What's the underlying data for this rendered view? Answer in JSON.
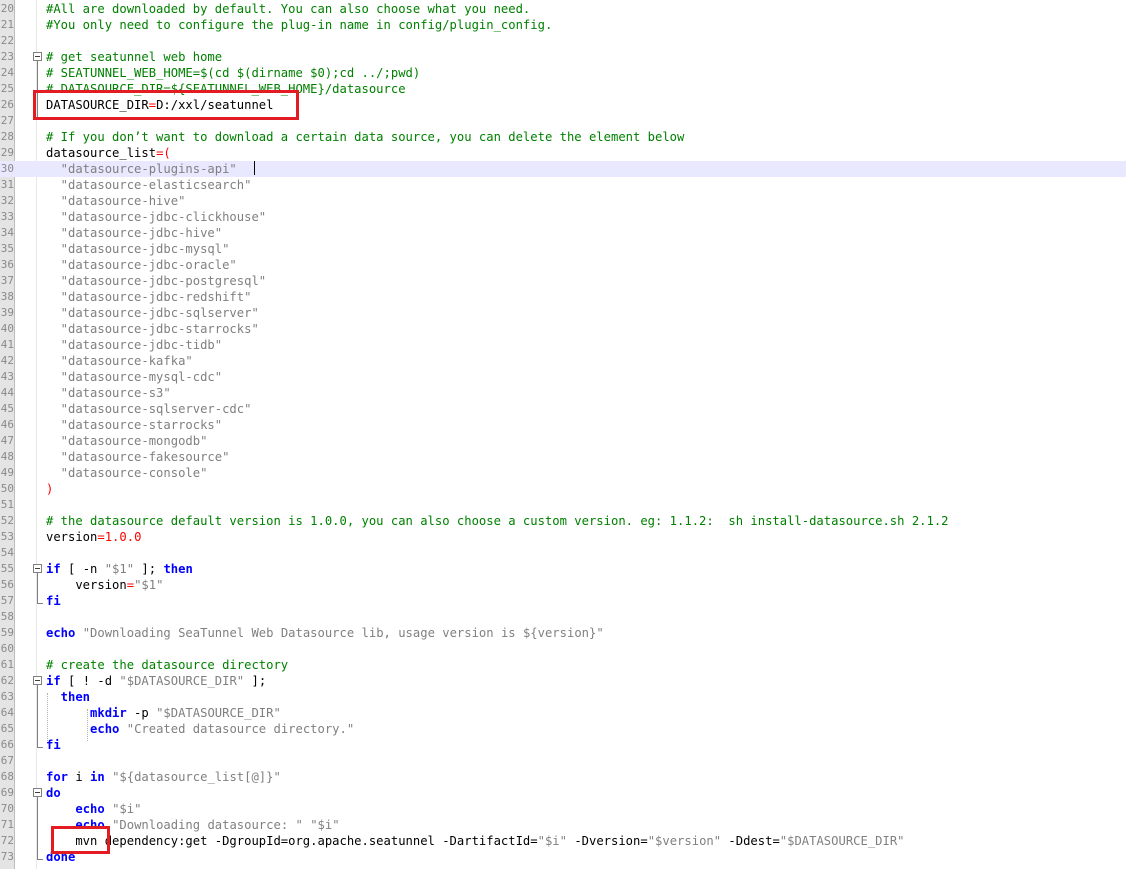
{
  "editor": {
    "lines": [
      {
        "no": "20",
        "parts": [
          {
            "c": "com",
            "t": "#All are downloaded by default. You can also choose what you need."
          }
        ]
      },
      {
        "no": "21",
        "parts": [
          {
            "c": "com",
            "t": "#You only need to configure the plug-in name in config/plugin_config."
          }
        ]
      },
      {
        "no": "22",
        "parts": []
      },
      {
        "no": "23",
        "parts": [
          {
            "c": "com",
            "t": "# get seatunnel web home"
          }
        ]
      },
      {
        "no": "24",
        "parts": [
          {
            "c": "com",
            "t": "# SEATUNNEL_WEB_HOME=$(cd $(dirname $0);cd ../;pwd)"
          }
        ]
      },
      {
        "no": "25",
        "parts": [
          {
            "c": "com",
            "t": "# DATASOURCE_DIR=${SEATUNNEL_WEB_HOME}/datasource"
          }
        ]
      },
      {
        "no": "26",
        "parts": [
          {
            "c": "plain",
            "t": "DATASOURCE_DIR"
          },
          {
            "c": "op",
            "t": "="
          },
          {
            "c": "plain",
            "t": "D:/xxl/seatunnel"
          }
        ]
      },
      {
        "no": "27",
        "parts": []
      },
      {
        "no": "28",
        "parts": [
          {
            "c": "com",
            "t": "# If you don’t want to download a certain data source, you can delete the element below"
          }
        ]
      },
      {
        "no": "29",
        "parts": [
          {
            "c": "plain",
            "t": "datasource_list"
          },
          {
            "c": "op",
            "t": "=("
          }
        ]
      },
      {
        "no": "30",
        "parts": [
          {
            "c": "str",
            "t": "  \"datasource-plugins-api\""
          }
        ]
      },
      {
        "no": "31",
        "parts": [
          {
            "c": "str",
            "t": "  \"datasource-elasticsearch\""
          }
        ]
      },
      {
        "no": "32",
        "parts": [
          {
            "c": "str",
            "t": "  \"datasource-hive\""
          }
        ]
      },
      {
        "no": "33",
        "parts": [
          {
            "c": "str",
            "t": "  \"datasource-jdbc-clickhouse\""
          }
        ]
      },
      {
        "no": "34",
        "parts": [
          {
            "c": "str",
            "t": "  \"datasource-jdbc-hive\""
          }
        ]
      },
      {
        "no": "35",
        "parts": [
          {
            "c": "str",
            "t": "  \"datasource-jdbc-mysql\""
          }
        ]
      },
      {
        "no": "36",
        "parts": [
          {
            "c": "str",
            "t": "  \"datasource-jdbc-oracle\""
          }
        ]
      },
      {
        "no": "37",
        "parts": [
          {
            "c": "str",
            "t": "  \"datasource-jdbc-postgresql\""
          }
        ]
      },
      {
        "no": "38",
        "parts": [
          {
            "c": "str",
            "t": "  \"datasource-jdbc-redshift\""
          }
        ]
      },
      {
        "no": "39",
        "parts": [
          {
            "c": "str",
            "t": "  \"datasource-jdbc-sqlserver\""
          }
        ]
      },
      {
        "no": "40",
        "parts": [
          {
            "c": "str",
            "t": "  \"datasource-jdbc-starrocks\""
          }
        ]
      },
      {
        "no": "41",
        "parts": [
          {
            "c": "str",
            "t": "  \"datasource-jdbc-tidb\""
          }
        ]
      },
      {
        "no": "42",
        "parts": [
          {
            "c": "str",
            "t": "  \"datasource-kafka\""
          }
        ]
      },
      {
        "no": "43",
        "parts": [
          {
            "c": "str",
            "t": "  \"datasource-mysql-cdc\""
          }
        ]
      },
      {
        "no": "44",
        "parts": [
          {
            "c": "str",
            "t": "  \"datasource-s3\""
          }
        ]
      },
      {
        "no": "45",
        "parts": [
          {
            "c": "str",
            "t": "  \"datasource-sqlserver-cdc\""
          }
        ]
      },
      {
        "no": "46",
        "parts": [
          {
            "c": "str",
            "t": "  \"datasource-starrocks\""
          }
        ]
      },
      {
        "no": "47",
        "parts": [
          {
            "c": "str",
            "t": "  \"datasource-mongodb\""
          }
        ]
      },
      {
        "no": "48",
        "parts": [
          {
            "c": "str",
            "t": "  \"datasource-fakesource\""
          }
        ]
      },
      {
        "no": "49",
        "parts": [
          {
            "c": "str",
            "t": "  \"datasource-console\""
          }
        ]
      },
      {
        "no": "50",
        "parts": [
          {
            "c": "op",
            "t": ")"
          }
        ]
      },
      {
        "no": "51",
        "parts": []
      },
      {
        "no": "52",
        "parts": [
          {
            "c": "com",
            "t": "# the datasource default version is 1.0.0, you can also choose a custom version. eg: 1.1.2:  sh install-datasource.sh 2.1.2"
          }
        ]
      },
      {
        "no": "53",
        "parts": [
          {
            "c": "plain",
            "t": "version"
          },
          {
            "c": "op",
            "t": "="
          },
          {
            "c": "num",
            "t": "1.0.0"
          }
        ]
      },
      {
        "no": "54",
        "parts": []
      },
      {
        "no": "55",
        "parts": [
          {
            "c": "kw",
            "t": "if"
          },
          {
            "c": "plain",
            "t": " [ -n "
          },
          {
            "c": "str",
            "t": "\"$1\""
          },
          {
            "c": "plain",
            "t": " ]; "
          },
          {
            "c": "kw",
            "t": "then"
          }
        ]
      },
      {
        "no": "56",
        "parts": [
          {
            "c": "plain",
            "t": "    version"
          },
          {
            "c": "op",
            "t": "="
          },
          {
            "c": "str",
            "t": "\"$1\""
          }
        ]
      },
      {
        "no": "57",
        "parts": [
          {
            "c": "kw",
            "t": "fi"
          }
        ]
      },
      {
        "no": "58",
        "parts": []
      },
      {
        "no": "59",
        "parts": [
          {
            "c": "kw",
            "t": "echo"
          },
          {
            "c": "plain",
            "t": " "
          },
          {
            "c": "str",
            "t": "\"Downloading SeaTunnel Web Datasource lib, usage version is ${version}\""
          }
        ]
      },
      {
        "no": "60",
        "parts": []
      },
      {
        "no": "61",
        "parts": [
          {
            "c": "com",
            "t": "# create the datasource directory"
          }
        ]
      },
      {
        "no": "62",
        "parts": [
          {
            "c": "kw",
            "t": "if"
          },
          {
            "c": "plain",
            "t": " [ ! -d "
          },
          {
            "c": "str",
            "t": "\"$DATASOURCE_DIR\""
          },
          {
            "c": "plain",
            "t": " ];"
          }
        ]
      },
      {
        "no": "63",
        "parts": [
          {
            "c": "kw",
            "t": "  then"
          }
        ]
      },
      {
        "no": "64",
        "parts": [
          {
            "c": "plain",
            "t": "      "
          },
          {
            "c": "kw",
            "t": "mkdir"
          },
          {
            "c": "plain",
            "t": " -p "
          },
          {
            "c": "str",
            "t": "\"$DATASOURCE_DIR\""
          }
        ]
      },
      {
        "no": "65",
        "parts": [
          {
            "c": "plain",
            "t": "      "
          },
          {
            "c": "kw",
            "t": "echo"
          },
          {
            "c": "plain",
            "t": " "
          },
          {
            "c": "str",
            "t": "\"Created datasource directory.\""
          }
        ]
      },
      {
        "no": "66",
        "parts": [
          {
            "c": "kw",
            "t": "fi"
          }
        ]
      },
      {
        "no": "67",
        "parts": []
      },
      {
        "no": "68",
        "parts": [
          {
            "c": "kw",
            "t": "for"
          },
          {
            "c": "plain",
            "t": " i "
          },
          {
            "c": "kw",
            "t": "in"
          },
          {
            "c": "plain",
            "t": " "
          },
          {
            "c": "str",
            "t": "\"${datasource_list[@]}\""
          }
        ]
      },
      {
        "no": "69",
        "parts": [
          {
            "c": "kw",
            "t": "do"
          }
        ]
      },
      {
        "no": "70",
        "parts": [
          {
            "c": "plain",
            "t": "    "
          },
          {
            "c": "kw",
            "t": "echo"
          },
          {
            "c": "plain",
            "t": " "
          },
          {
            "c": "str",
            "t": "\"$i\""
          }
        ]
      },
      {
        "no": "71",
        "parts": [
          {
            "c": "plain",
            "t": "    "
          },
          {
            "c": "kw",
            "t": "echo"
          },
          {
            "c": "plain",
            "t": " "
          },
          {
            "c": "str",
            "t": "\"Downloading datasource: \""
          },
          {
            "c": "plain",
            "t": " "
          },
          {
            "c": "str",
            "t": "\"$i\""
          }
        ]
      },
      {
        "no": "72",
        "parts": [
          {
            "c": "plain",
            "t": "    mvn dependency:get -DgroupId=org.apache.seatunnel -DartifactId="
          },
          {
            "c": "str",
            "t": "\"$i\""
          },
          {
            "c": "plain",
            "t": " -Dversion="
          },
          {
            "c": "str",
            "t": "\"$version\""
          },
          {
            "c": "plain",
            "t": " -Ddest="
          },
          {
            "c": "str",
            "t": "\"$DATASOURCE_DIR\""
          }
        ]
      },
      {
        "no": "73",
        "parts": [
          {
            "c": "kw",
            "t": "done"
          }
        ]
      }
    ]
  }
}
